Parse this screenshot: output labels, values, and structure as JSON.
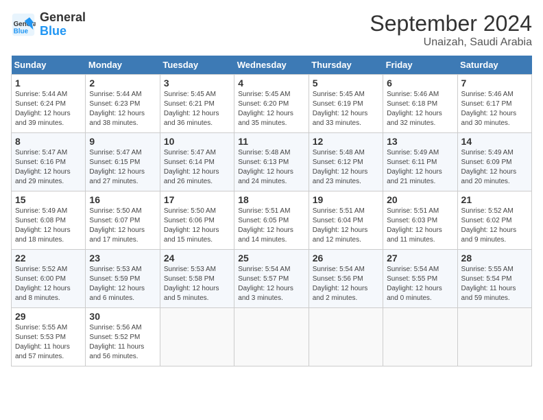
{
  "logo": {
    "line1": "General",
    "line2": "Blue"
  },
  "title": "September 2024",
  "subtitle": "Unaizah, Saudi Arabia",
  "days_header": [
    "Sunday",
    "Monday",
    "Tuesday",
    "Wednesday",
    "Thursday",
    "Friday",
    "Saturday"
  ],
  "weeks": [
    [
      {
        "day": "1",
        "info": "Sunrise: 5:44 AM\nSunset: 6:24 PM\nDaylight: 12 hours\nand 39 minutes."
      },
      {
        "day": "2",
        "info": "Sunrise: 5:44 AM\nSunset: 6:23 PM\nDaylight: 12 hours\nand 38 minutes."
      },
      {
        "day": "3",
        "info": "Sunrise: 5:45 AM\nSunset: 6:21 PM\nDaylight: 12 hours\nand 36 minutes."
      },
      {
        "day": "4",
        "info": "Sunrise: 5:45 AM\nSunset: 6:20 PM\nDaylight: 12 hours\nand 35 minutes."
      },
      {
        "day": "5",
        "info": "Sunrise: 5:45 AM\nSunset: 6:19 PM\nDaylight: 12 hours\nand 33 minutes."
      },
      {
        "day": "6",
        "info": "Sunrise: 5:46 AM\nSunset: 6:18 PM\nDaylight: 12 hours\nand 32 minutes."
      },
      {
        "day": "7",
        "info": "Sunrise: 5:46 AM\nSunset: 6:17 PM\nDaylight: 12 hours\nand 30 minutes."
      }
    ],
    [
      {
        "day": "8",
        "info": "Sunrise: 5:47 AM\nSunset: 6:16 PM\nDaylight: 12 hours\nand 29 minutes."
      },
      {
        "day": "9",
        "info": "Sunrise: 5:47 AM\nSunset: 6:15 PM\nDaylight: 12 hours\nand 27 minutes."
      },
      {
        "day": "10",
        "info": "Sunrise: 5:47 AM\nSunset: 6:14 PM\nDaylight: 12 hours\nand 26 minutes."
      },
      {
        "day": "11",
        "info": "Sunrise: 5:48 AM\nSunset: 6:13 PM\nDaylight: 12 hours\nand 24 minutes."
      },
      {
        "day": "12",
        "info": "Sunrise: 5:48 AM\nSunset: 6:12 PM\nDaylight: 12 hours\nand 23 minutes."
      },
      {
        "day": "13",
        "info": "Sunrise: 5:49 AM\nSunset: 6:11 PM\nDaylight: 12 hours\nand 21 minutes."
      },
      {
        "day": "14",
        "info": "Sunrise: 5:49 AM\nSunset: 6:09 PM\nDaylight: 12 hours\nand 20 minutes."
      }
    ],
    [
      {
        "day": "15",
        "info": "Sunrise: 5:49 AM\nSunset: 6:08 PM\nDaylight: 12 hours\nand 18 minutes."
      },
      {
        "day": "16",
        "info": "Sunrise: 5:50 AM\nSunset: 6:07 PM\nDaylight: 12 hours\nand 17 minutes."
      },
      {
        "day": "17",
        "info": "Sunrise: 5:50 AM\nSunset: 6:06 PM\nDaylight: 12 hours\nand 15 minutes."
      },
      {
        "day": "18",
        "info": "Sunrise: 5:51 AM\nSunset: 6:05 PM\nDaylight: 12 hours\nand 14 minutes."
      },
      {
        "day": "19",
        "info": "Sunrise: 5:51 AM\nSunset: 6:04 PM\nDaylight: 12 hours\nand 12 minutes."
      },
      {
        "day": "20",
        "info": "Sunrise: 5:51 AM\nSunset: 6:03 PM\nDaylight: 12 hours\nand 11 minutes."
      },
      {
        "day": "21",
        "info": "Sunrise: 5:52 AM\nSunset: 6:02 PM\nDaylight: 12 hours\nand 9 minutes."
      }
    ],
    [
      {
        "day": "22",
        "info": "Sunrise: 5:52 AM\nSunset: 6:00 PM\nDaylight: 12 hours\nand 8 minutes."
      },
      {
        "day": "23",
        "info": "Sunrise: 5:53 AM\nSunset: 5:59 PM\nDaylight: 12 hours\nand 6 minutes."
      },
      {
        "day": "24",
        "info": "Sunrise: 5:53 AM\nSunset: 5:58 PM\nDaylight: 12 hours\nand 5 minutes."
      },
      {
        "day": "25",
        "info": "Sunrise: 5:54 AM\nSunset: 5:57 PM\nDaylight: 12 hours\nand 3 minutes."
      },
      {
        "day": "26",
        "info": "Sunrise: 5:54 AM\nSunset: 5:56 PM\nDaylight: 12 hours\nand 2 minutes."
      },
      {
        "day": "27",
        "info": "Sunrise: 5:54 AM\nSunset: 5:55 PM\nDaylight: 12 hours\nand 0 minutes."
      },
      {
        "day": "28",
        "info": "Sunrise: 5:55 AM\nSunset: 5:54 PM\nDaylight: 11 hours\nand 59 minutes."
      }
    ],
    [
      {
        "day": "29",
        "info": "Sunrise: 5:55 AM\nSunset: 5:53 PM\nDaylight: 11 hours\nand 57 minutes."
      },
      {
        "day": "30",
        "info": "Sunrise: 5:56 AM\nSunset: 5:52 PM\nDaylight: 11 hours\nand 56 minutes."
      },
      {
        "day": "",
        "info": ""
      },
      {
        "day": "",
        "info": ""
      },
      {
        "day": "",
        "info": ""
      },
      {
        "day": "",
        "info": ""
      },
      {
        "day": "",
        "info": ""
      }
    ]
  ]
}
